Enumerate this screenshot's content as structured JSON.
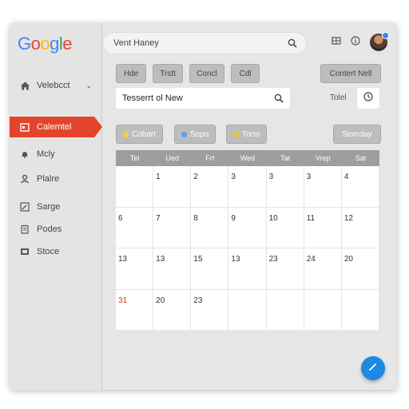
{
  "logo": {
    "letters": [
      {
        "ch": "G",
        "color": "#4285F4"
      },
      {
        "ch": "o",
        "color": "#EA4335"
      },
      {
        "ch": "o",
        "color": "#FBBC05"
      },
      {
        "ch": "g",
        "color": "#4285F4"
      },
      {
        "ch": "l",
        "color": "#34A853"
      },
      {
        "ch": "e",
        "color": "#EA4335"
      }
    ]
  },
  "search": {
    "placeholder": "Vent Haney",
    "icon": "search-icon"
  },
  "topbar": {
    "icons": [
      "grid-icon",
      "info-icon",
      "avatar"
    ]
  },
  "sidebar": {
    "account": {
      "label": "Velebcct",
      "icon": "home-icon"
    },
    "items": [
      {
        "label": "Calemtel",
        "icon": "calendar-icon",
        "active": true
      },
      {
        "label": "Mcly",
        "icon": "bell-icon"
      },
      {
        "label": "Plalre",
        "icon": "person-icon"
      },
      {
        "label": "Sarge",
        "icon": "edit-box-icon"
      },
      {
        "label": "Podes",
        "icon": "clipboard-icon"
      },
      {
        "label": "Stoce",
        "icon": "storage-icon"
      }
    ]
  },
  "toolbar": {
    "buttons": [
      "Hde",
      "Trstt",
      "Concl",
      "Cdl"
    ],
    "right_button": "Contert Nell"
  },
  "subject": {
    "value": "Tesserrt ol New",
    "icon": "search-icon"
  },
  "total": {
    "label": "Tolel",
    "icon": "clock-icon"
  },
  "chips": [
    {
      "label": "Cobart",
      "dot_color": "#f3d33a"
    },
    {
      "label": "Sopo",
      "dot_color": "#5aa0f0"
    },
    {
      "label": "Torto",
      "dot_color": "#f3c22a"
    }
  ],
  "seerday": "Seerday",
  "calendar": {
    "headers": [
      "Tel",
      "Ued",
      "Frt",
      "Wed",
      "Tat",
      "Vrep",
      "Sat"
    ],
    "rows": [
      [
        "",
        "1",
        "2",
        "3",
        "3",
        "3",
        "4"
      ],
      [
        "6",
        "7",
        "8",
        "9",
        "10",
        "11",
        "12"
      ],
      [
        "13",
        "13",
        "15",
        "13",
        "23",
        "24",
        "20"
      ],
      [
        "31",
        "20",
        "23",
        "",
        "",
        "",
        ""
      ]
    ],
    "red_cells": [
      "3-0"
    ]
  },
  "fab": {
    "icon": "pencil-icon"
  }
}
